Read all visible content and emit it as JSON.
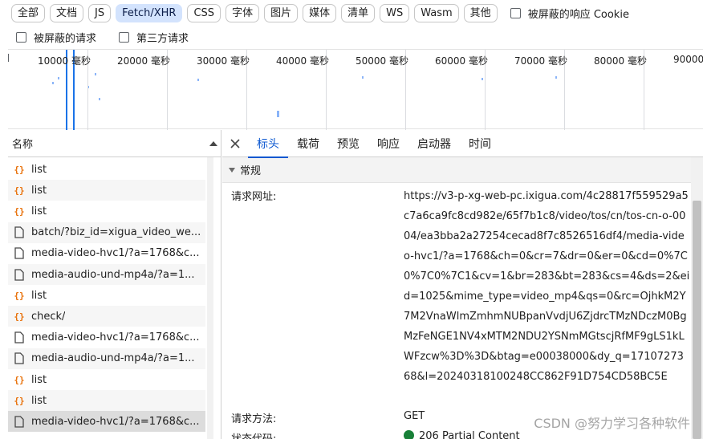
{
  "filters": {
    "chips": [
      {
        "label": "全部",
        "active": false
      },
      {
        "label": "文档",
        "active": false
      },
      {
        "label": "JS",
        "active": false
      },
      {
        "label": "Fetch/XHR",
        "active": true
      },
      {
        "label": "CSS",
        "active": false
      },
      {
        "label": "字体",
        "active": false
      },
      {
        "label": "图片",
        "active": false
      },
      {
        "label": "媒体",
        "active": false
      },
      {
        "label": "清单",
        "active": false
      },
      {
        "label": "WS",
        "active": false
      },
      {
        "label": "Wasm",
        "active": false
      },
      {
        "label": "其他",
        "active": false
      }
    ],
    "blocked_cookies_label": "被屏蔽的响应 Cookie",
    "blocked_requests_label": "被屏蔽的请求",
    "third_party_label": "第三方请求"
  },
  "overview": {
    "ticks": [
      "10000 毫秒",
      "20000 毫秒",
      "30000 毫秒",
      "40000 毫秒",
      "50000 毫秒",
      "60000 毫秒",
      "70000 毫秒",
      "80000 毫秒",
      "90000"
    ]
  },
  "list": {
    "header": "名称",
    "rows": [
      {
        "type": "xhr",
        "name": "list"
      },
      {
        "type": "xhr",
        "name": "list"
      },
      {
        "type": "xhr",
        "name": "list"
      },
      {
        "type": "doc",
        "name": "batch/?biz_id=xigua_video_we..."
      },
      {
        "type": "doc",
        "name": "media-video-hvc1/?a=1768&c..."
      },
      {
        "type": "doc",
        "name": "media-audio-und-mp4a/?a=1..."
      },
      {
        "type": "xhr",
        "name": "list"
      },
      {
        "type": "xhr",
        "name": "check/"
      },
      {
        "type": "doc",
        "name": "media-video-hvc1/?a=1768&c..."
      },
      {
        "type": "doc",
        "name": "media-audio-und-mp4a/?a=1..."
      },
      {
        "type": "xhr",
        "name": "list"
      },
      {
        "type": "xhr",
        "name": "list"
      },
      {
        "type": "doc",
        "name": "media-video-hvc1/?a=1768&c..."
      }
    ]
  },
  "detail": {
    "tabs": [
      "标头",
      "载荷",
      "预览",
      "响应",
      "启动器",
      "时间"
    ],
    "section": "常规",
    "url_key": "请求网址:",
    "url_value": "https://v3-p-xg-web-pc.ixigua.com/4c28817f559529a5c7a6ca9fc8cd982e/65f7b1c8/video/tos/cn/tos-cn-o-0004/ea3bba2a27254cecad8f7c8526516df4/media-video-hvc1/?a=1768&ch=0&cr=7&dr=0&er=0&cd=0%7C0%7C0%7C1&cv=1&br=283&bt=283&cs=4&ds=2&eid=1025&mime_type=video_mp4&qs=0&rc=OjhkM2Y7M2VnaWlmZmhmNUBpanVvdjU6ZjdrcTMzNDczM0BgMzFeNGE1NV4xMTM2NDU2YSNmMGtscjRfMF9gLS1kLWFzcw%3D%3D&btag=e00038000&dy_q=1710727368&l=20240318100248CC862F91D754CD58BC5E",
    "method_key": "请求方法:",
    "method_value": "GET",
    "status_key": "状态代码:",
    "status_value": "206 Partial Content"
  },
  "watermark": "CSDN @努力学习各种软件",
  "colors": {
    "accent": "#0b57d0",
    "active_chip": "#d3e3fd",
    "status_ok": "#188038"
  }
}
